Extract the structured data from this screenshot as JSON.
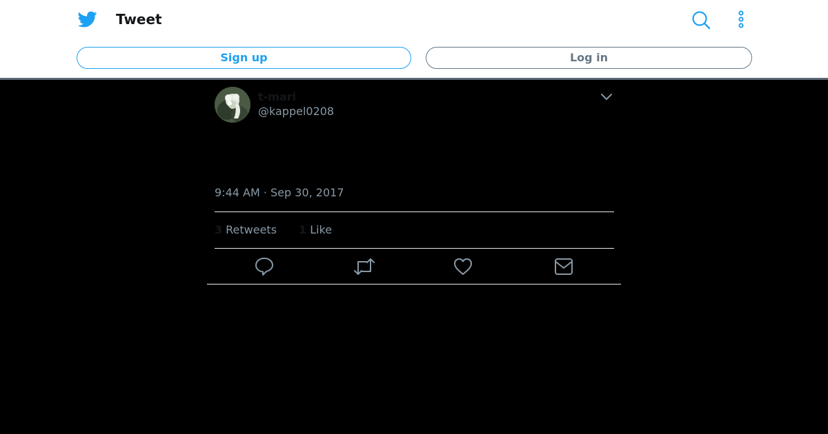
{
  "header": {
    "title": "Tweet",
    "icons": [
      "twitter-bird-icon",
      "search-icon",
      "more-vertical-icon"
    ],
    "signup_label": "Sign up",
    "login_label": "Log in"
  },
  "tweet": {
    "display_name": "t-mari",
    "handle": "@kappel0208",
    "timestamp": "9:44 AM · Sep 30, 2017",
    "retweets_count": "3",
    "retweets_label": "Retweets",
    "likes_count": "1",
    "likes_label": "Like",
    "actions": [
      "reply-icon",
      "retweet-icon",
      "like-icon",
      "direct-message-icon"
    ]
  },
  "colors": {
    "brand": "#1da1f2",
    "secondary_text": "#8899a6",
    "background": "#000000"
  }
}
